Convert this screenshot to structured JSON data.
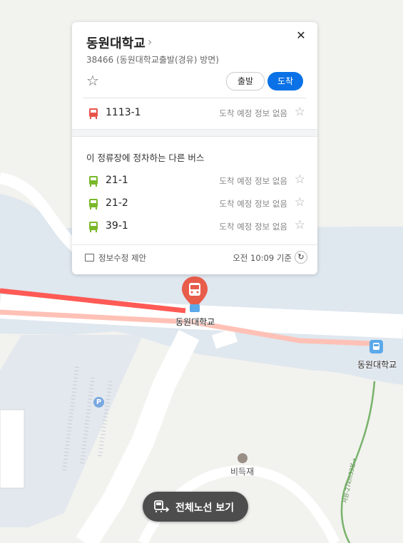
{
  "stop": {
    "name": "동원대학교",
    "chevron": "›",
    "subtitle": "38466 (동원대학교출발(경유) 방면)",
    "close": "✕",
    "favorite_icon": "star-outline-icon",
    "departure_label": "출발",
    "arrival_label": "도착"
  },
  "main_bus": {
    "number": "1113-1",
    "status": "도착 예정 정보 없음",
    "color": "#e8534a"
  },
  "other_section_title": "이 정류장에 정차하는 다른 버스",
  "other_buses": [
    {
      "number": "21-1",
      "status": "도착 예정 정보 없음",
      "color": "#7ab829"
    },
    {
      "number": "21-2",
      "status": "도착 예정 정보 없음",
      "color": "#7ab829"
    },
    {
      "number": "39-1",
      "status": "도착 예정 정보 없음",
      "color": "#7ab829"
    }
  ],
  "footer": {
    "suggest_label": "정보수정 제안",
    "time_label": "오전 10:09 기준",
    "refresh_icon": "refresh-icon"
  },
  "map": {
    "marker_label": "동원대학교",
    "stop2_label": "동원대학교",
    "place_label": "비득재",
    "parking_icon": "P",
    "trail_label": "서원-27km33분→"
  },
  "route_button": {
    "label": "전체노선 보기"
  },
  "colors": {
    "accent": "#0a72e6",
    "route_red": "#ff5a55",
    "marker": "#e85c4a",
    "water": "#dfe7ef"
  }
}
